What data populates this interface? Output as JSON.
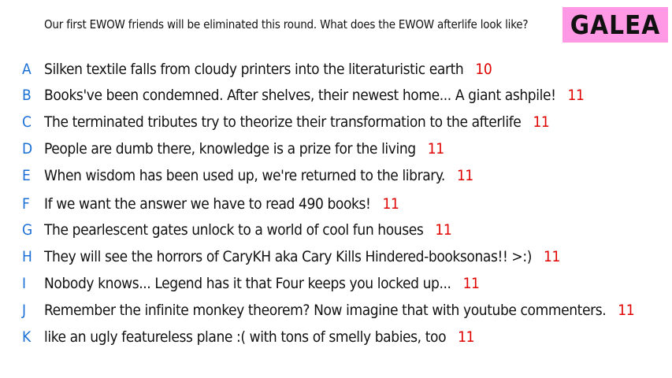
{
  "question": "Our first EWOW friends will be eliminated this round. What does the EWOW afterlife look like?",
  "contestant_name": "GALEA",
  "colors": {
    "letter": "#1a6fd6",
    "word_count": "#e00000",
    "badge_bg": "#ff99e6"
  },
  "responses": [
    {
      "letter": "A",
      "text": "Silken textile falls from cloudy printers into the literaturistic earth",
      "word_count": "10"
    },
    {
      "letter": "B",
      "text": "Books've been condemned. After shelves, their newest home... A giant ashpile!",
      "word_count": "11"
    },
    {
      "letter": "C",
      "text": "The terminated tributes try to theorize their transformation to the afterlife",
      "word_count": "11"
    },
    {
      "letter": "D",
      "text": "People are dumb there, knowledge is a prize for the living",
      "word_count": "11"
    },
    {
      "letter": "E",
      "text": "When wisdom has been used up, we're returned to the library.",
      "word_count": "11"
    },
    {
      "letter": "F",
      "text": "If we want the answer we have to read 490 books!",
      "word_count": "11"
    },
    {
      "letter": "G",
      "text": "The pearlescent gates unlock to a world of cool fun houses",
      "word_count": "11"
    },
    {
      "letter": "H",
      "text": "They will see the horrors of CaryKH aka Cary Kills Hindered-booksonas!! >:)",
      "word_count": "11"
    },
    {
      "letter": "I",
      "text": "Nobody knows... Legend has it that Four keeps you locked up...",
      "word_count": "11"
    },
    {
      "letter": "J",
      "text": "Remember the infinite monkey theorem? Now imagine that with youtube commenters.",
      "word_count": "11"
    },
    {
      "letter": "K",
      "text": "like an ugly featureless plane :( with tons of smelly babies, too",
      "word_count": "11"
    }
  ]
}
